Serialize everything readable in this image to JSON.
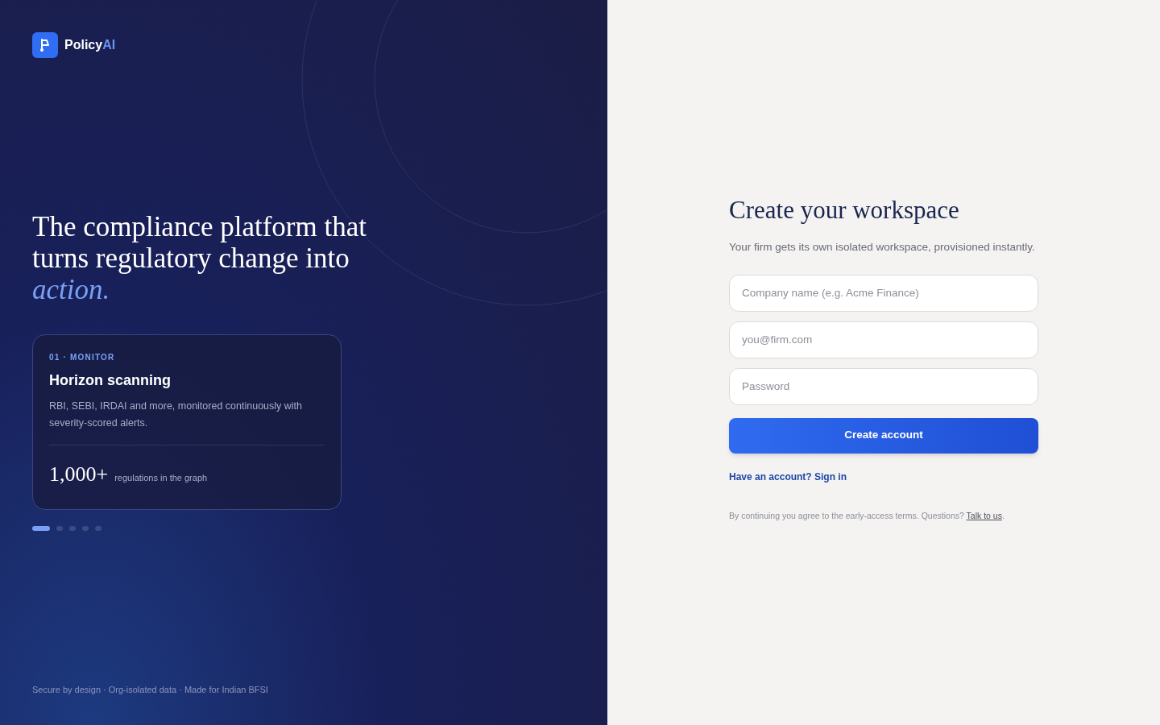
{
  "brand": {
    "name": "Policy",
    "accent": "AI"
  },
  "headline": {
    "text": "The compliance platform that turns regulatory change into",
    "accent": "action."
  },
  "feature_card": {
    "eyebrow": "01 · MONITOR",
    "title": "Horizon scanning",
    "description": "RBI, SEBI, IRDAI and more, monitored continuously with severity-scored alerts.",
    "stat": "1,000+",
    "stat_label": "regulations in the graph"
  },
  "carousel_dots": [
    {
      "selected": true
    },
    {
      "selected": false
    },
    {
      "selected": false
    },
    {
      "selected": false
    },
    {
      "selected": false
    }
  ],
  "left_footer": "Secure by design · Org-isolated data · Made for Indian BFSI",
  "form": {
    "title": "Create your workspace",
    "subtitle": "Your firm gets its own isolated workspace, provisioned instantly.",
    "fields": [
      {
        "placeholder": "Company name (e.g. Acme Finance)"
      },
      {
        "placeholder": "you@firm.com"
      },
      {
        "placeholder": "Password"
      }
    ],
    "submit": "Create account",
    "signin_link": "Have an account? Sign in",
    "terms": "By continuing you agree to the early-access terms. Questions?",
    "terms_link": "Talk to us",
    "terms_end": "."
  }
}
